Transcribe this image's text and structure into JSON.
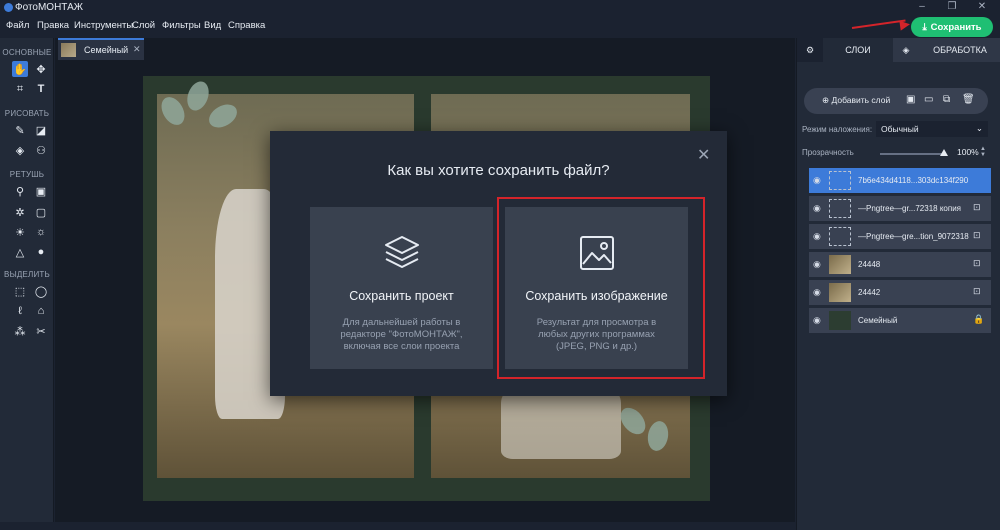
{
  "app": {
    "title": "ФотоМОНТАЖ"
  },
  "menu": [
    "Файл",
    "Правка",
    "Инструменты",
    "Слой",
    "Фильтры",
    "Вид",
    "Справка"
  ],
  "save_button": {
    "label": "Сохранить"
  },
  "toolbar": {
    "sections": [
      {
        "title": "ОСНОВНЫЕ",
        "tools": [
          "hand-icon",
          "move-icon",
          "crop-icon",
          "text-icon"
        ]
      },
      {
        "title": "РИСОВАТЬ",
        "tools": [
          "brush-icon",
          "eraser-icon",
          "fill-icon",
          "clone-icon"
        ]
      },
      {
        "title": "РЕТУШЬ",
        "tools": [
          "patch-icon",
          "stamp-icon",
          "heal-icon",
          "select-area-icon",
          "brightness-icon",
          "contrast-icon",
          "sharpen-icon",
          "blur-icon"
        ]
      },
      {
        "title": "ВЫДЕЛИТЬ",
        "tools": [
          "rect-select-icon",
          "ellipse-select-icon",
          "lasso-icon",
          "poly-lasso-icon",
          "magic-wand-icon",
          "quick-select-icon"
        ]
      }
    ]
  },
  "document_tab": {
    "name": "Семейный",
    "close": "✕"
  },
  "dialog": {
    "title": "Как вы хотите сохранить файл?",
    "close": "✕",
    "options": [
      {
        "title": "Сохранить проект",
        "description": "Для дальнейшей работы в редакторе \"ФотоМОНТАЖ\", включая все слои проекта",
        "icon": "layers-icon"
      },
      {
        "title": "Сохранить изображение",
        "description": "Результат для просмотра в любых других программах (JPEG, PNG и др.)",
        "icon": "image-icon"
      }
    ]
  },
  "right_panel": {
    "tabs": {
      "layers": "СЛОИ",
      "processing": "ОБРАБОТКА"
    },
    "add_layer": "Добавить слой",
    "blend_label": "Режим наложения:",
    "blend_value": "Обычный",
    "opacity_label": "Прозрачность",
    "opacity_value": "100%",
    "opacity_level": 1.0,
    "layers": [
      {
        "name": "7b6e434d4118...303dc134f290",
        "selected": true
      },
      {
        "name": "—Pngtree—gr...72318 копия",
        "selected": false
      },
      {
        "name": "—Pngtree—gre...tion_9072318",
        "selected": false
      },
      {
        "name": "24448",
        "selected": false
      },
      {
        "name": "24442",
        "selected": false
      },
      {
        "name": "Семейный",
        "selected": false
      }
    ]
  },
  "colors": {
    "accent": "#3d7bd9",
    "save_green": "#1fbf73",
    "highlight_red": "#d4242a"
  }
}
